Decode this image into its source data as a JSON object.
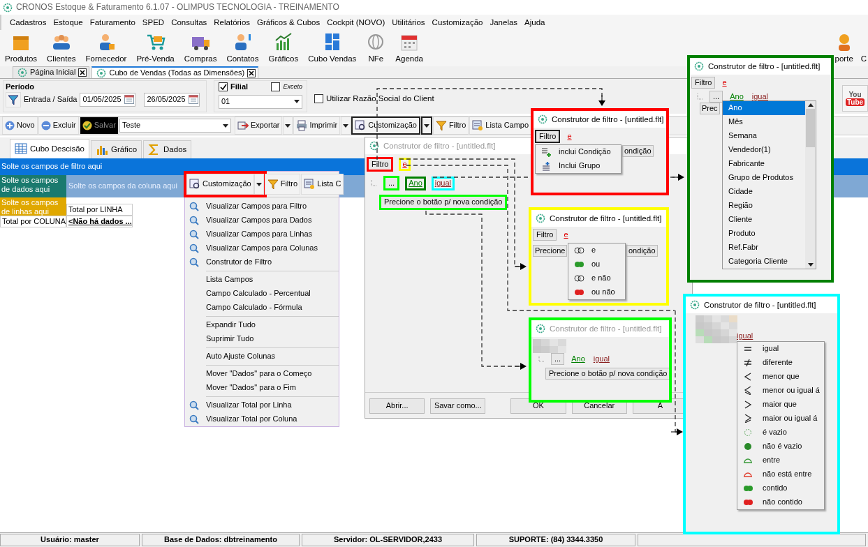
{
  "window": {
    "title": "CRONOS Estoque & Faturamento 6.1.07 - OLIMPUS TECNOLOGIA - TREINAMENTO"
  },
  "menu": [
    "Cadastros",
    "Estoque",
    "Faturamento",
    "SPED",
    "Consultas",
    "Relatórios",
    "Gráficos & Cubos",
    "Cockpit (NOVO)",
    "Utilitários",
    "Customização",
    "Janelas",
    "Ajuda"
  ],
  "toolbar": [
    {
      "label": "Produtos"
    },
    {
      "label": "Clientes"
    },
    {
      "label": "Fornecedor"
    },
    {
      "label": "Pré-Venda"
    },
    {
      "label": "Compras"
    },
    {
      "label": "Contatos"
    },
    {
      "label": "Gráficos"
    },
    {
      "label": "Cubo Vendas"
    },
    {
      "label": "NFe"
    },
    {
      "label": "Agenda"
    }
  ],
  "toolbar_right": [
    {
      "label": "porte",
      "kind": "icon"
    },
    {
      "label": "C",
      "kind": "text"
    }
  ],
  "doc_tabs": [
    {
      "label": "Página Inicial",
      "selected": false
    },
    {
      "label": "Cubo de Vendas (Todas as Dimensões)",
      "selected": true
    }
  ],
  "period": {
    "title": "Período",
    "label": "Entrada / Saída",
    "date_from": "01/05/2025",
    "date_to": "26/05/2025"
  },
  "filial": {
    "label": "Filial",
    "checked": true,
    "except_label": "Exceto",
    "except_checked": false,
    "value": "01"
  },
  "razao_social": {
    "label": "Utilizar Razão Social do Client",
    "checked": false
  },
  "youtube_logo": {
    "top": "You",
    "bottom": "Tube"
  },
  "actions": {
    "buttons": [
      {
        "label": "Novo",
        "highlighted": false
      },
      {
        "label": "Excluir",
        "highlighted": false
      },
      {
        "label": "Salvar",
        "highlighted": true
      }
    ],
    "layout_value": "Teste",
    "tools": [
      {
        "label": "Exportar",
        "dropdown": true,
        "pressed": false
      },
      {
        "label": "Imprimir",
        "dropdown": true,
        "pressed": false
      },
      {
        "label": "Customização",
        "dropdown": true,
        "pressed": true
      },
      {
        "label": "Filtro",
        "dropdown": false,
        "pressed": false
      },
      {
        "label": "Lista Campo",
        "dropdown": false,
        "pressed": false
      }
    ]
  },
  "view_tabs": [
    {
      "label": "Cubo Descisão",
      "selected": true
    },
    {
      "label": "Gráfico",
      "selected": false
    },
    {
      "label": "Dados",
      "selected": false
    }
  ],
  "pivot": {
    "filter_drop": "Solte os campos de filtro aqui",
    "data_drop": "Solte os campos de dados aqui",
    "column_drop": "Solte os campos da coluna aqui",
    "row_drop": "Solte os campos de linhas aqui",
    "row_total": "Total por LINHA",
    "column_total": "Total por COLUNA",
    "no_data": "<Não há dados ..."
  },
  "context_popup": {
    "tools": [
      {
        "label": "Customização",
        "dropdown": true,
        "color": "#ff0000"
      },
      {
        "label": "Filtro",
        "dropdown": false
      },
      {
        "label": "Lista C",
        "dropdown": false
      }
    ],
    "items": [
      {
        "kind": "icon",
        "label": "Visualizar Campos para Filtro"
      },
      {
        "kind": "icon",
        "label": "Visualizar Campos para Dados"
      },
      {
        "kind": "icon",
        "label": "Visualizar Campos para Linhas"
      },
      {
        "kind": "icon",
        "label": "Visualizar Campos para Colunas"
      },
      {
        "kind": "icon",
        "label": "Construtor de Filtro"
      },
      {
        "kind": "separator"
      },
      {
        "kind": "plain",
        "label": "Lista Campos"
      },
      {
        "kind": "plain",
        "label": "Campo Calculado - Percentual"
      },
      {
        "kind": "plain",
        "label": "Campo Calculado - Fórmula"
      },
      {
        "kind": "separator"
      },
      {
        "kind": "plain",
        "label": "Expandir Tudo"
      },
      {
        "kind": "plain",
        "label": "Suprimir Tudo"
      },
      {
        "kind": "separator"
      },
      {
        "kind": "plain",
        "label": "Auto Ajuste Colunas"
      },
      {
        "kind": "separator"
      },
      {
        "kind": "plain",
        "label": "Mover \"Dados\" para o Começo"
      },
      {
        "kind": "plain",
        "label": "Mover \"Dados\" para o Fim"
      },
      {
        "kind": "separator"
      },
      {
        "kind": "icon",
        "label": "Visualizar Total por Linha"
      },
      {
        "kind": "icon",
        "label": "Visualizar Total por Coluna"
      }
    ]
  },
  "filter_dialog": {
    "title": "Construtor de filtro - [untitled.flt]",
    "active": false,
    "root_button": {
      "label": "Filtro",
      "color": "#ff0000"
    },
    "operator": {
      "label": "e",
      "color": "#ffff00"
    },
    "more": {
      "label": "...",
      "color": "#00ff00"
    },
    "field": {
      "label": "Ano",
      "color": "#008000"
    },
    "comparison": {
      "label": "igual",
      "color": "#00ffff"
    },
    "new_condition": {
      "label": "Precione o botão p/ nova condição",
      "color": "#00ff00"
    },
    "buttons": [
      "Abrir...",
      "Savar como...",
      "OK",
      "Cancelar",
      "A"
    ]
  },
  "insets": [
    {
      "kind": "group_menu",
      "color": "#ff0000",
      "title": "Construtor de filtro - [untitled.flt]",
      "active": true,
      "root_button": "Filtro",
      "operator": "e",
      "button_tail": "ondição",
      "menu": [
        "inclui Condição",
        "Inclui Grupo"
      ]
    },
    {
      "kind": "logic_menu",
      "color": "#ffff00",
      "title": "Construtor de filtro - [untitled.flt]",
      "active": true,
      "root_button": "Filtro",
      "operator": "e",
      "button_head": "Precione",
      "button_tail": "ondição",
      "menu": [
        {
          "label": "e",
          "kind": "and"
        },
        {
          "label": "ou",
          "kind": "or"
        },
        {
          "label": "e não",
          "kind": "and_not"
        },
        {
          "label": "ou não",
          "kind": "or_not"
        }
      ]
    },
    {
      "kind": "condition",
      "color": "#00ff00",
      "title": "Construtor de filtro - [untitled.flt]",
      "active": false,
      "more": "...",
      "field": "Ano",
      "comparison": "igual",
      "new_condition": "Precione o botão p/ nova condição"
    },
    {
      "kind": "field_list",
      "color": "#008000",
      "title": "Construtor de filtro - [untitled.flt]",
      "active": true,
      "root_button": "Filtro",
      "operator": "e",
      "more": "...",
      "field": "Ano",
      "comparison": "igual",
      "button_head": "Prec",
      "fields": [
        {
          "label": "Ano",
          "selected": true
        },
        {
          "label": "Mês",
          "selected": false
        },
        {
          "label": "Semana",
          "selected": false
        },
        {
          "label": "Vendedor(1)",
          "selected": false
        },
        {
          "label": "Fabricante",
          "selected": false
        },
        {
          "label": "Grupo de Produtos",
          "selected": false
        },
        {
          "label": "Cidade",
          "selected": false
        },
        {
          "label": "Região",
          "selected": false
        },
        {
          "label": "Cliente",
          "selected": false
        },
        {
          "label": "Produto",
          "selected": false
        },
        {
          "label": "Ref.Fabr",
          "selected": false
        },
        {
          "label": "Categoria Cliente",
          "selected": false
        }
      ]
    },
    {
      "kind": "operator_menu",
      "color": "#00ffff",
      "title": "Construtor de filtro - [untitled.flt]",
      "active": true,
      "comparison": "igual",
      "operators": [
        {
          "label": "igual",
          "kind": "eq"
        },
        {
          "label": "diferente",
          "kind": "ne"
        },
        {
          "label": "menor que",
          "kind": "lt"
        },
        {
          "label": "menor ou igual á",
          "kind": "le"
        },
        {
          "label": "maior que",
          "kind": "gt"
        },
        {
          "label": "maior ou igual á",
          "kind": "ge"
        },
        {
          "label": "é vazio",
          "kind": "empty"
        },
        {
          "label": "não é vazio",
          "kind": "not_empty"
        },
        {
          "label": "entre",
          "kind": "between"
        },
        {
          "label": "não está entre",
          "kind": "not_between"
        },
        {
          "label": "contido",
          "kind": "in"
        },
        {
          "label": "não contido",
          "kind": "not_in"
        }
      ]
    }
  ],
  "status_bar": [
    "Usuário: master",
    "Base de Dados: dbtreinamento",
    "Servidor: OL-SERVIDOR,2433",
    "SUPORTE: (84) 3344.3350"
  ]
}
